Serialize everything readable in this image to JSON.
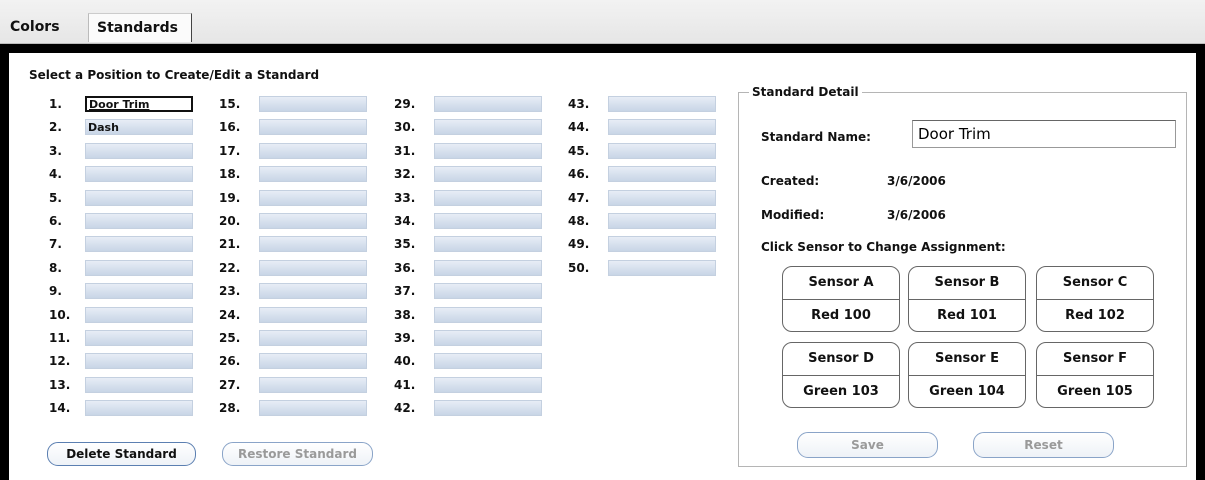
{
  "tabs": [
    {
      "label": "Colors"
    },
    {
      "label": "Standards"
    }
  ],
  "positions_title": "Select a Position to Create/Edit a Standard",
  "slots": [
    {
      "num": "1.",
      "value": "Door Trim"
    },
    {
      "num": "2.",
      "value": "Dash"
    },
    {
      "num": "3.",
      "value": ""
    },
    {
      "num": "4.",
      "value": ""
    },
    {
      "num": "5.",
      "value": ""
    },
    {
      "num": "6.",
      "value": ""
    },
    {
      "num": "7.",
      "value": ""
    },
    {
      "num": "8.",
      "value": ""
    },
    {
      "num": "9.",
      "value": ""
    },
    {
      "num": "10.",
      "value": ""
    },
    {
      "num": "11.",
      "value": ""
    },
    {
      "num": "12.",
      "value": ""
    },
    {
      "num": "13.",
      "value": ""
    },
    {
      "num": "14.",
      "value": ""
    },
    {
      "num": "15.",
      "value": ""
    },
    {
      "num": "16.",
      "value": ""
    },
    {
      "num": "17.",
      "value": ""
    },
    {
      "num": "18.",
      "value": ""
    },
    {
      "num": "19.",
      "value": ""
    },
    {
      "num": "20.",
      "value": ""
    },
    {
      "num": "21.",
      "value": ""
    },
    {
      "num": "22.",
      "value": ""
    },
    {
      "num": "23.",
      "value": ""
    },
    {
      "num": "24.",
      "value": ""
    },
    {
      "num": "25.",
      "value": ""
    },
    {
      "num": "26.",
      "value": ""
    },
    {
      "num": "27.",
      "value": ""
    },
    {
      "num": "28.",
      "value": ""
    },
    {
      "num": "29.",
      "value": ""
    },
    {
      "num": "30.",
      "value": ""
    },
    {
      "num": "31.",
      "value": ""
    },
    {
      "num": "32.",
      "value": ""
    },
    {
      "num": "33.",
      "value": ""
    },
    {
      "num": "34.",
      "value": ""
    },
    {
      "num": "35.",
      "value": ""
    },
    {
      "num": "36.",
      "value": ""
    },
    {
      "num": "37.",
      "value": ""
    },
    {
      "num": "38.",
      "value": ""
    },
    {
      "num": "39.",
      "value": ""
    },
    {
      "num": "40.",
      "value": ""
    },
    {
      "num": "41.",
      "value": ""
    },
    {
      "num": "42.",
      "value": ""
    },
    {
      "num": "43.",
      "value": ""
    },
    {
      "num": "44.",
      "value": ""
    },
    {
      "num": "45.",
      "value": ""
    },
    {
      "num": "46.",
      "value": ""
    },
    {
      "num": "47.",
      "value": ""
    },
    {
      "num": "48.",
      "value": ""
    },
    {
      "num": "49.",
      "value": ""
    },
    {
      "num": "50.",
      "value": ""
    }
  ],
  "selected_slot": "1.",
  "buttons": {
    "delete": "Delete Standard",
    "restore": "Restore Standard",
    "save": "Save",
    "reset": "Reset"
  },
  "detail": {
    "group_title": "Standard Detail",
    "name_label": "Standard Name:",
    "name_value": "Door Trim",
    "created_label": "Created:",
    "created_value": "3/6/2006",
    "modified_label": "Modified:",
    "modified_value": "3/6/2006",
    "sensor_prompt": "Click Sensor to Change Assignment:",
    "sensors": [
      {
        "name": "Sensor A",
        "value": "Red 100"
      },
      {
        "name": "Sensor B",
        "value": "Red 101"
      },
      {
        "name": "Sensor C",
        "value": "Red 102"
      },
      {
        "name": "Sensor D",
        "value": "Green 103"
      },
      {
        "name": "Sensor E",
        "value": "Green 104"
      },
      {
        "name": "Sensor F",
        "value": "Green 105"
      }
    ]
  },
  "colors": {
    "accent_border": "#5b7fb1",
    "empty_slot": "#c8d5e6",
    "frame": "#000000"
  }
}
